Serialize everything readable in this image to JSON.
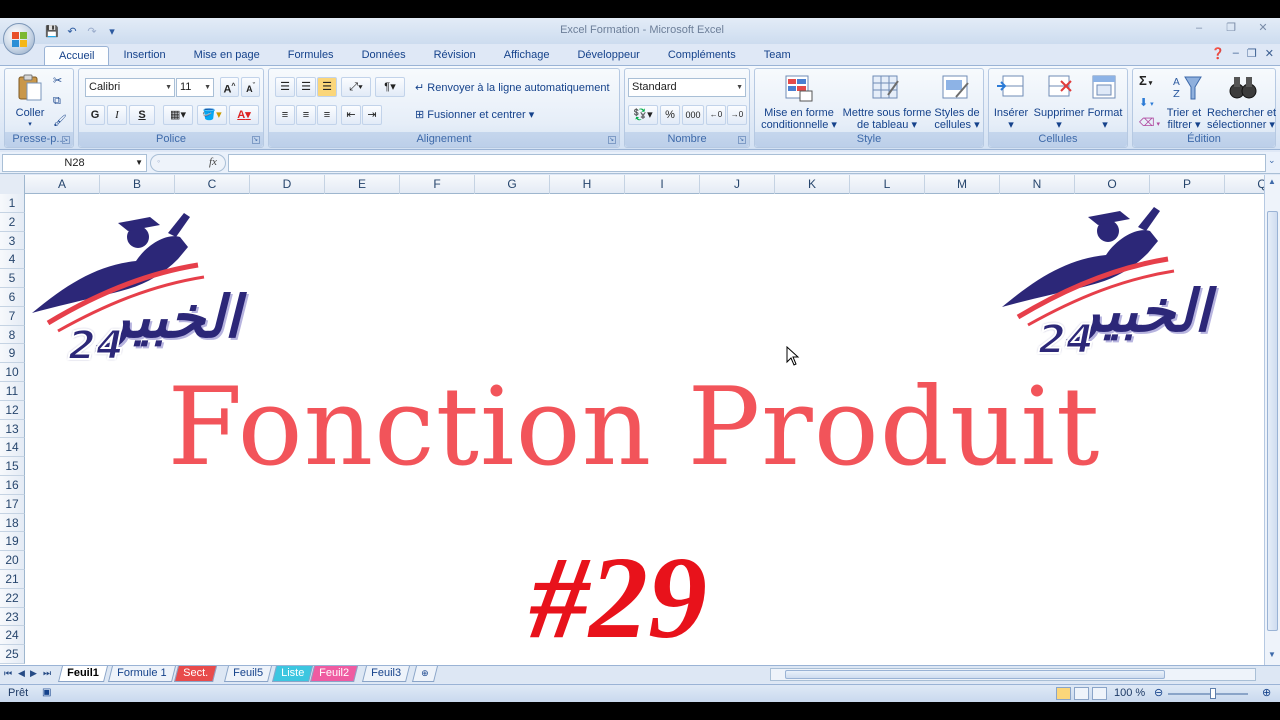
{
  "window": {
    "title": "Excel Formation - Microsoft Excel"
  },
  "qat": {
    "save": "💾",
    "undo": "↶",
    "redo": "↷",
    "more": "▾"
  },
  "tabs": [
    "Accueil",
    "Insertion",
    "Mise en page",
    "Formules",
    "Données",
    "Révision",
    "Affichage",
    "Développeur",
    "Compléments",
    "Team"
  ],
  "ribbon": {
    "clipboard": {
      "label": "Presse-p...",
      "paste": "Coller"
    },
    "font": {
      "label": "Police",
      "name": "Calibri",
      "size": "11",
      "bold": "G",
      "italic": "I",
      "underline": "S"
    },
    "alignment": {
      "label": "Alignement",
      "wrap": "Renvoyer à la ligne automatiquement",
      "merge": "Fusionner et centrer"
    },
    "number": {
      "label": "Nombre",
      "format": "Standard",
      "percent": "%",
      "thousands": "000"
    },
    "style": {
      "label": "Style",
      "cond_format_1": "Mise en forme",
      "cond_format_2": "conditionnelle",
      "table_1": "Mettre sous forme",
      "table_2": "de tableau",
      "cell_styles_1": "Styles de",
      "cell_styles_2": "cellules"
    },
    "cells": {
      "label": "Cellules",
      "insert": "Insérer",
      "delete": "Supprimer",
      "format": "Format"
    },
    "editing": {
      "label": "Édition",
      "sort_1": "Trier et",
      "sort_2": "filtrer",
      "find_1": "Rechercher et",
      "find_2": "sélectionner",
      "sum": "Σ"
    }
  },
  "formula_bar": {
    "name_box": "N28",
    "fx": "fx",
    "content": ""
  },
  "columns": [
    "A",
    "B",
    "C",
    "D",
    "E",
    "F",
    "G",
    "H",
    "I",
    "J",
    "K",
    "L",
    "M",
    "N",
    "O",
    "P",
    "Q"
  ],
  "rows": [
    "1",
    "2",
    "3",
    "4",
    "5",
    "6",
    "7",
    "8",
    "9",
    "10",
    "11",
    "12",
    "13",
    "14",
    "15",
    "16",
    "17",
    "18",
    "19",
    "20",
    "21",
    "22",
    "23",
    "24",
    "25"
  ],
  "content": {
    "title": "Fonction Produit",
    "number": "#29",
    "logo_text": "الخبير",
    "logo_number": "24"
  },
  "sheets": [
    {
      "name": "Feuil1",
      "color": "",
      "active": true
    },
    {
      "name": "Formule 1",
      "color": "",
      "active": false
    },
    {
      "name": "Sect.",
      "color": "#e84b4b",
      "active": false
    },
    {
      "name": "Feuil5",
      "color": "",
      "active": false
    },
    {
      "name": "Liste",
      "color": "#3cc6e0",
      "active": false
    },
    {
      "name": "Feuil2",
      "color": "#ef5ba1",
      "active": false
    },
    {
      "name": "Feuil3",
      "color": "",
      "active": false
    }
  ],
  "status": {
    "text": "Prêt",
    "zoom": "100 %"
  },
  "colors": {
    "title": "#f2545a",
    "number": "#e8121b",
    "logo": "#2c2778"
  }
}
